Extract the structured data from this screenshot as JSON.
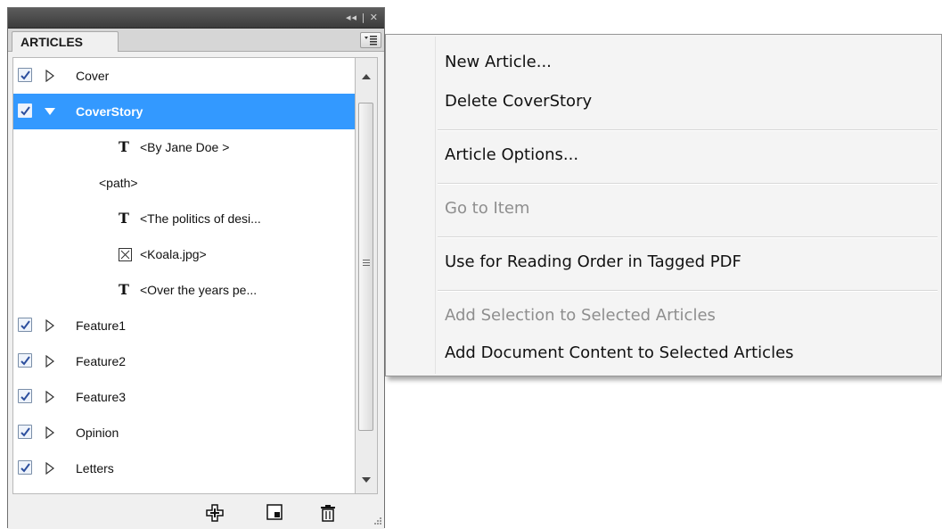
{
  "panel": {
    "tab_label": "ARTICLES",
    "titlebar_controls": "◂◂ | ✕",
    "rows": [
      {
        "label": "Cover",
        "checked": true,
        "expanded": false
      },
      {
        "label": "CoverStory",
        "checked": true,
        "expanded": true,
        "selected": true
      },
      {
        "label": "<By Jane Doe >",
        "type": "text-icon"
      },
      {
        "label": "<path>",
        "type": "path"
      },
      {
        "label": "<The politics of desi...",
        "type": "text-icon"
      },
      {
        "label": "<Koala.jpg>",
        "type": "graphic-icon"
      },
      {
        "label": "<Over the years pe...",
        "type": "text-icon"
      },
      {
        "label": "Feature1",
        "checked": true,
        "expanded": false
      },
      {
        "label": "Feature2",
        "checked": true,
        "expanded": false
      },
      {
        "label": "Feature3",
        "checked": true,
        "expanded": false
      },
      {
        "label": "Opinion",
        "checked": true,
        "expanded": false
      },
      {
        "label": "Letters",
        "checked": true,
        "expanded": false
      }
    ],
    "text_icon_glyph": "T",
    "bottom_icons": [
      "add-content-icon",
      "new-article-icon",
      "trash-icon"
    ]
  },
  "menu": {
    "items": [
      {
        "label": "New Article...",
        "enabled": true
      },
      {
        "label": "Delete CoverStory",
        "enabled": true
      },
      {
        "label": "Article Options...",
        "enabled": true
      },
      {
        "label": "Go to Item",
        "enabled": false
      },
      {
        "label": "Use for Reading Order in Tagged PDF",
        "enabled": true
      },
      {
        "label": "Add Selection to Selected Articles",
        "enabled": false
      },
      {
        "label": "Add Document Content to Selected Articles",
        "enabled": true
      }
    ]
  },
  "colors": {
    "selection": "#3399ff",
    "disabled_text": "#8e8e8e",
    "titlebar": "#4a4a4a"
  }
}
